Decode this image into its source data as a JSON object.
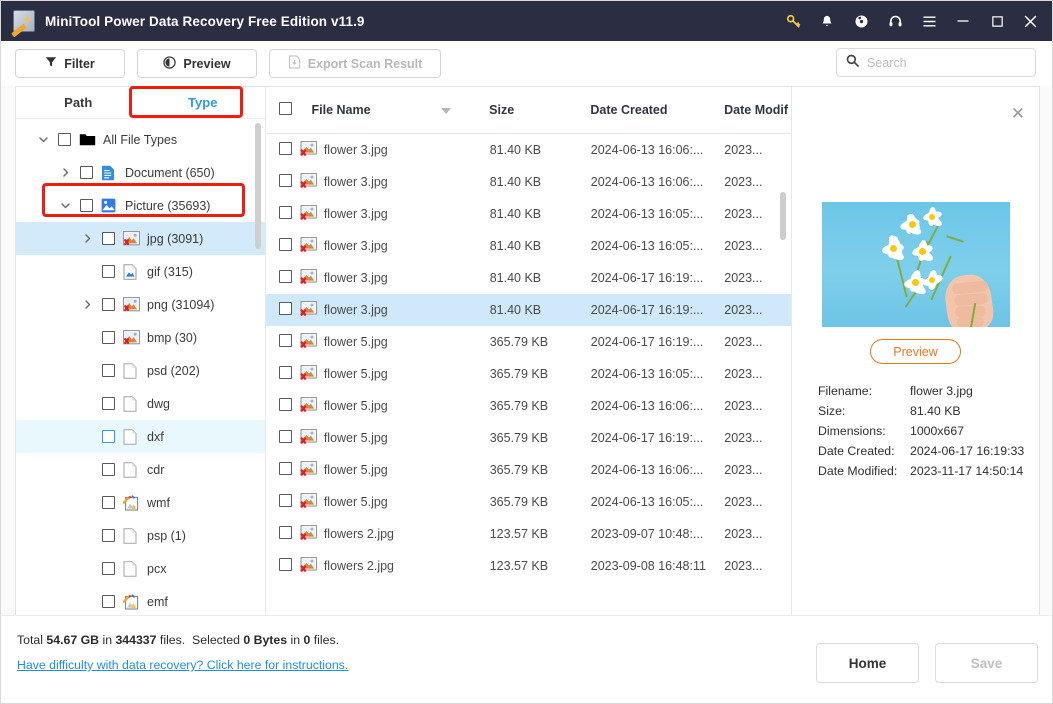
{
  "window": {
    "title": "MiniTool Power Data Recovery Free Edition v11.9",
    "logo_icon": "minitool-logo-icon",
    "controls": [
      {
        "name": "key-icon",
        "glyph": "key"
      },
      {
        "name": "bell-icon",
        "glyph": "bell"
      },
      {
        "name": "disc-icon",
        "glyph": "disc"
      },
      {
        "name": "headset-icon",
        "glyph": "headset"
      },
      {
        "name": "menu-icon",
        "glyph": "menu"
      },
      {
        "name": "minimize-button",
        "glyph": "minimize"
      },
      {
        "name": "maximize-button",
        "glyph": "maximize"
      },
      {
        "name": "close-button",
        "glyph": "close"
      }
    ]
  },
  "toolbar": {
    "filter_label": "Filter",
    "preview_label": "Preview",
    "export_label": "Export Scan Result"
  },
  "search": {
    "placeholder": "Search",
    "value": ""
  },
  "tree": {
    "tabs": [
      {
        "label": "Path",
        "active": false
      },
      {
        "label": "Type",
        "active": true
      }
    ],
    "nodes": [
      {
        "label": "All File Types",
        "indent": 0,
        "caret": "down",
        "icon": "folder-icon",
        "state": "none"
      },
      {
        "label": "Document (650)",
        "indent": 1,
        "caret": "right",
        "icon": "document-icon",
        "state": "none"
      },
      {
        "label": "Picture (35693)",
        "indent": 1,
        "caret": "down",
        "icon": "picture-icon",
        "state": "none"
      },
      {
        "label": "jpg (3091)",
        "indent": 2,
        "caret": "right",
        "icon": "image-icon",
        "state": "sel-blue"
      },
      {
        "label": "gif (315)",
        "indent": 2,
        "caret": "none",
        "icon": "gif-icon",
        "state": "none"
      },
      {
        "label": "png (31094)",
        "indent": 2,
        "caret": "right",
        "icon": "image-icon",
        "state": "none"
      },
      {
        "label": "bmp (30)",
        "indent": 2,
        "caret": "none",
        "icon": "image-icon",
        "state": "none"
      },
      {
        "label": "psd (202)",
        "indent": 2,
        "caret": "none",
        "icon": "blank-file-icon",
        "state": "none"
      },
      {
        "label": "dwg",
        "indent": 2,
        "caret": "none",
        "icon": "blank-file-icon",
        "state": "none"
      },
      {
        "label": "dxf",
        "indent": 2,
        "caret": "none",
        "icon": "blank-file-icon",
        "state": "sel-cyan"
      },
      {
        "label": "cdr",
        "indent": 2,
        "caret": "none",
        "icon": "blank-file-icon",
        "state": "none"
      },
      {
        "label": "wmf",
        "indent": 2,
        "caret": "none",
        "icon": "metafile-icon",
        "state": "none"
      },
      {
        "label": "psp (1)",
        "indent": 2,
        "caret": "none",
        "icon": "blank-file-icon",
        "state": "none"
      },
      {
        "label": "pcx",
        "indent": 2,
        "caret": "none",
        "icon": "blank-file-icon",
        "state": "none"
      },
      {
        "label": "emf",
        "indent": 2,
        "caret": "none",
        "icon": "metafile-icon",
        "state": "none"
      }
    ]
  },
  "table": {
    "columns": [
      "File Name",
      "Size",
      "Date Created",
      "Date Modif"
    ],
    "sorted_column": "File Name",
    "rows": [
      {
        "name": "flower 3.jpg",
        "size": "81.40 KB",
        "created": "2024-06-13 16:06:...",
        "modified": "2023...",
        "selected": false
      },
      {
        "name": "flower 3.jpg",
        "size": "81.40 KB",
        "created": "2024-06-13 16:06:...",
        "modified": "2023...",
        "selected": false
      },
      {
        "name": "flower 3.jpg",
        "size": "81.40 KB",
        "created": "2024-06-13 16:05:...",
        "modified": "2023...",
        "selected": false
      },
      {
        "name": "flower 3.jpg",
        "size": "81.40 KB",
        "created": "2024-06-13 16:05:...",
        "modified": "2023...",
        "selected": false
      },
      {
        "name": "flower 3.jpg",
        "size": "81.40 KB",
        "created": "2024-06-17 16:19:...",
        "modified": "2023...",
        "selected": false
      },
      {
        "name": "flower 3.jpg",
        "size": "81.40 KB",
        "created": "2024-06-17 16:19:...",
        "modified": "2023...",
        "selected": true
      },
      {
        "name": "flower 5.jpg",
        "size": "365.79 KB",
        "created": "2024-06-17 16:19:...",
        "modified": "2023...",
        "selected": false
      },
      {
        "name": "flower 5.jpg",
        "size": "365.79 KB",
        "created": "2024-06-13 16:05:...",
        "modified": "2023...",
        "selected": false
      },
      {
        "name": "flower 5.jpg",
        "size": "365.79 KB",
        "created": "2024-06-13 16:06:...",
        "modified": "2023...",
        "selected": false
      },
      {
        "name": "flower 5.jpg",
        "size": "365.79 KB",
        "created": "2024-06-17 16:19:...",
        "modified": "2023...",
        "selected": false
      },
      {
        "name": "flower 5.jpg",
        "size": "365.79 KB",
        "created": "2024-06-13 16:06:...",
        "modified": "2023...",
        "selected": false
      },
      {
        "name": "flower 5.jpg",
        "size": "365.79 KB",
        "created": "2024-06-13 16:05:...",
        "modified": "2023...",
        "selected": false
      },
      {
        "name": "flowers 2.jpg",
        "size": "123.57 KB",
        "created": "2023-09-07 10:48:...",
        "modified": "2023...",
        "selected": false
      },
      {
        "name": "flowers 2.jpg",
        "size": "123.57 KB",
        "created": "2023-09-08 16:48:11",
        "modified": "2023...",
        "selected": false
      }
    ]
  },
  "preview": {
    "close_icon": "close-icon",
    "button_label": "Preview",
    "image_alt": "white daisies held by a hand on blue background",
    "meta": [
      {
        "key": "Filename:",
        "value": "flower 3.jpg"
      },
      {
        "key": "Size:",
        "value": "81.40 KB"
      },
      {
        "key": "Dimensions:",
        "value": "1000x667"
      },
      {
        "key": "Date Created:",
        "value": "2024-06-17 16:19:33"
      },
      {
        "key": "Date Modified:",
        "value": "2023-11-17 14:50:14"
      }
    ]
  },
  "footer": {
    "total_prefix": "Total ",
    "total_size": "54.67 GB",
    "total_mid": " in ",
    "total_files": "344337",
    "total_suffix": " files.",
    "selected_prefix": "Selected ",
    "selected_size": "0 Bytes",
    "selected_mid": " in ",
    "selected_files": "0",
    "selected_suffix": " files.",
    "help_link": "Have difficulty with data recovery? Click here for instructions.",
    "home_label": "Home",
    "save_label": "Save"
  },
  "annotations": {
    "color": "#f01d10",
    "boxes": [
      "type-tab",
      "picture-node"
    ]
  }
}
